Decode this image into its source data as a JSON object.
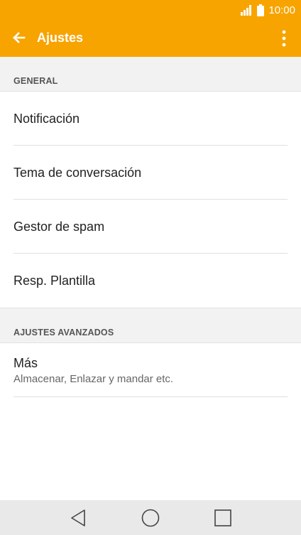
{
  "status_bar": {
    "time": "10:00",
    "signal_icon": "signal-icon",
    "battery_icon": "battery-icon"
  },
  "app_bar": {
    "title": "Ajustes",
    "back_icon": "back-arrow-icon",
    "menu_icon": "more-vert-icon"
  },
  "sections": [
    {
      "header": "GENERAL",
      "items": [
        {
          "label": "Notificación"
        },
        {
          "label": "Tema de conversación"
        },
        {
          "label": "Gestor de spam"
        },
        {
          "label": "Resp. Plantilla"
        }
      ]
    },
    {
      "header": "AJUSTES AVANZADOS",
      "items": [
        {
          "label": "Más",
          "subtitle": "Almacenar, Enlazar y mandar etc."
        }
      ]
    }
  ],
  "nav_bar": {
    "back": "nav-back-icon",
    "home": "nav-home-icon",
    "recents": "nav-recents-icon"
  },
  "colors": {
    "accent": "#f7a400",
    "background": "#ffffff",
    "section_bg": "#f2f2f2",
    "navbar_bg": "#e9e9e9"
  }
}
